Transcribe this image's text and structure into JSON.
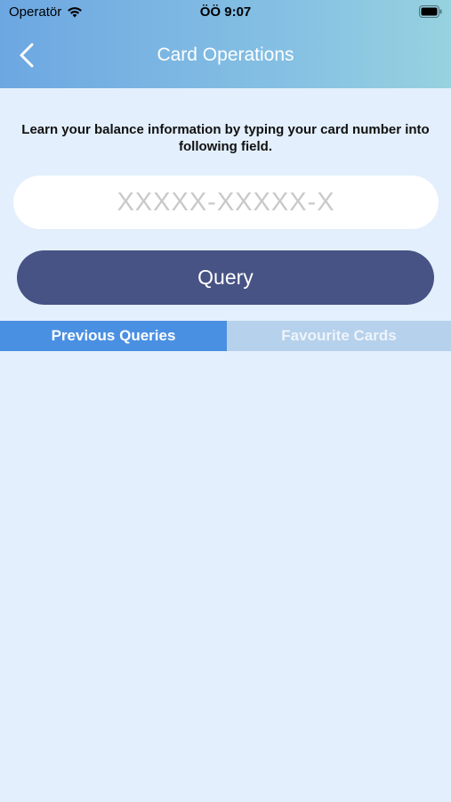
{
  "status_bar": {
    "carrier": "Operatör",
    "time": "ÖÖ 9:07"
  },
  "nav": {
    "title": "Card Operations",
    "back_icon": "chevron-left-icon"
  },
  "main": {
    "instruction": "Learn your balance information by typing your card number into following field.",
    "card_input": {
      "placeholder": "XXXXX-XXXXX-X",
      "value": ""
    },
    "query_label": "Query"
  },
  "tabs": [
    {
      "label": "Previous Queries",
      "active": true
    },
    {
      "label": "Favourite Cards",
      "active": false
    }
  ],
  "colors": {
    "header_gradient_start": "#6da7e2",
    "header_gradient_end": "#96d2df",
    "background": "#e3effc",
    "query_button": "#475285",
    "tab_active": "#4a90e2",
    "tab_inactive": "#b6d1ec"
  }
}
